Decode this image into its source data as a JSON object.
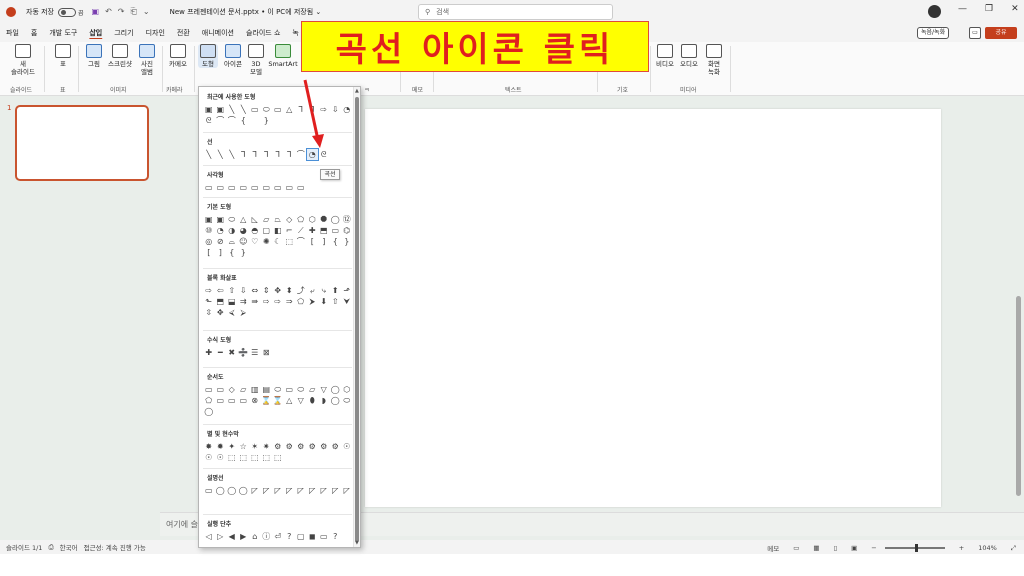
{
  "titlebar": {
    "autosave_label": "자동 저장",
    "autosave_state": "끔",
    "filename": "New 프레젠테이션 문서.pptx • 이 PC에 저장됨 ⌄",
    "search_placeholder": "검색"
  },
  "menu": {
    "tabs": [
      "파일",
      "홈",
      "개발 도구",
      "삽입",
      "그리기",
      "디자인",
      "전환",
      "애니메이션",
      "슬라이드 쇼",
      "녹"
    ],
    "active_tab": "삽입",
    "record_label": "녹음/녹화",
    "share_label": "공유"
  },
  "ribbon": {
    "buttons": {
      "new_slide": "새\n슬라이드",
      "table": "표",
      "picture": "그림",
      "screenshot": "스크린샷",
      "photo_album": "사진\n앨범",
      "camera": "카메오",
      "shapes": "도형",
      "icons": "아이콘",
      "model3d": "3D\n모델",
      "smartart": "SmartArt",
      "video": "비디오",
      "audio": "오디오",
      "screen_record": "화면\n녹화"
    },
    "groups": {
      "slides": "슬라이드",
      "table": "표",
      "images": "이미지",
      "camera": "카메라",
      "g5": "ㅋ",
      "comments": "메모",
      "text": "텍스트",
      "symbols": "기호",
      "media": "미디어"
    }
  },
  "slides_pane": {
    "slide_number": "1"
  },
  "notes": {
    "placeholder": "여기에 슬"
  },
  "statusbar": {
    "slide_info": "슬라이드 1/1",
    "language": "한국어",
    "accessibility": "접근성: 계속 진행 가능",
    "notes_btn": "메모",
    "zoom": "104%"
  },
  "shapes_menu": {
    "sections": [
      {
        "title": "최근에 사용한 도형",
        "icons": "▣▣╲╲▭⬭▭△⅂⅂⇨⇩◔ᘓ⌒⌒{ }"
      },
      {
        "title": "선",
        "icons": "╲╲╲⅂⅂⅂⅂⅂⌒◔ᘓ"
      },
      {
        "title": "사각형",
        "icons": "▭▭▭▭▭▭▭▭▭"
      },
      {
        "title": "기본 도형",
        "icons": "▣▣⬭△◺▱⏢◇⬠⬡⯃◯⑫⑩◔◑◕◓▢◧⌐⟋✚⬒▭⌬◎⊘⌓☺♡✺☾⬚⌒[]{}[]{}"
      },
      {
        "title": "블록 화살표",
        "icons": "⇨⇦⇧⇩⇔⇕✥⬍⤴⤶⤷⬆⬏⬑⬒⬓⇉⇛⇨⇨⇒⬠⮞⬇⇧⮟⇳✥⮘⮚"
      },
      {
        "title": "수식 도형",
        "icons": "✚━✖➗☰⊠"
      },
      {
        "title": "순서도",
        "icons": "▭▭◇▱▥▤⬭▭⬭▱▽◯⬡⬠▭▭▭⊗⌛⌛△▽⬮◗◯⬭◯"
      },
      {
        "title": "별 및 현수막",
        "icons": "✸✹✦☆✶✷⚙⚙⚙⚙⚙⚙☉☉☉⬚⬚⬚⬚⬚"
      },
      {
        "title": "설명선",
        "icons": "▭◯◯◯◸◸◸◸◸◸◸◸◸"
      },
      {
        "title": "실행 단추",
        "icons": "◁▷◀▶⌂ⓘ⏎?▢◼▭?"
      }
    ],
    "tooltip": "곡선"
  },
  "annotation": {
    "text": "곡선 아이콘 클릭"
  }
}
